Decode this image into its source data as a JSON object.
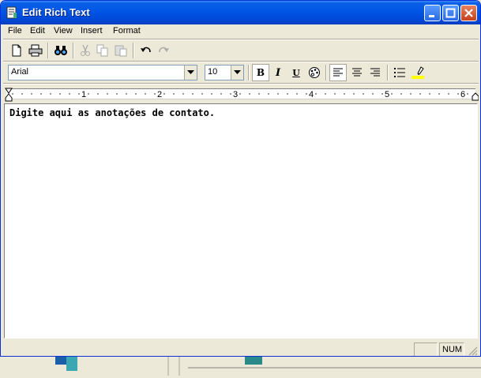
{
  "window": {
    "title": "Edit Rich Text",
    "icon": "document-edit-icon"
  },
  "menubar": {
    "items": [
      {
        "label": "File"
      },
      {
        "label": "Edit"
      },
      {
        "label": "View"
      },
      {
        "label": "Insert"
      },
      {
        "label": "Format"
      }
    ]
  },
  "toolbar": {
    "icons": [
      "new-document-icon",
      "print-icon",
      "find-icon",
      "cut-icon",
      "copy-icon",
      "paste-icon",
      "undo-icon",
      "redo-icon"
    ]
  },
  "format_bar": {
    "font_name": "Arial",
    "font_size": "10",
    "bold_glyph": "B",
    "italic_glyph": "I",
    "underline_glyph": "U",
    "bold_pressed": true,
    "align_left_pressed": true
  },
  "ruler": {
    "labels": [
      "1",
      "2",
      "3",
      "4",
      "5",
      "6"
    ]
  },
  "editor": {
    "text": "Digite aqui as anotações de contato."
  },
  "statusbar": {
    "num_label": "NUM"
  },
  "colors": {
    "titlebar": "#0055e5",
    "face": "#ece9d8",
    "highlight_yellow": "#ffff00"
  }
}
